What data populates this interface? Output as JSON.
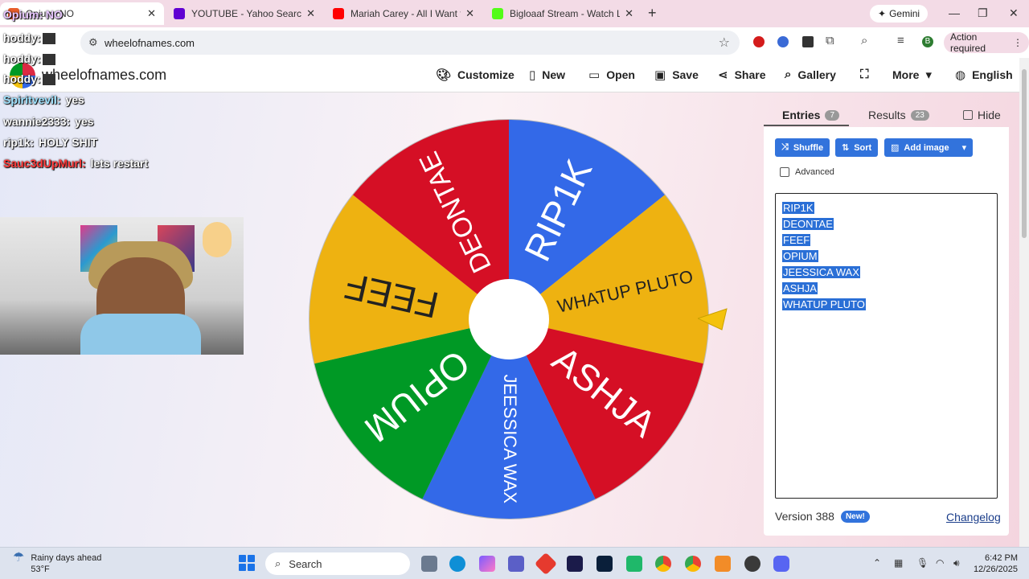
{
  "browser": {
    "tabs": [
      {
        "title": "Opium: NO",
        "favicon_color": "#e85d2a",
        "active": true
      },
      {
        "title": "YOUTUBE - Yahoo Search Resul",
        "favicon_color": "#6001d2"
      },
      {
        "title": "Mariah Carey - All I Want for Ch",
        "favicon_color": "#ff0000"
      },
      {
        "title": "Bigloaaf Stream - Watch Live o",
        "favicon_color": "#53fc18"
      }
    ],
    "new_tab_label": "+",
    "gemini_label": "Gemini",
    "url": "wheelofnames.com",
    "action_required_label": "Action required",
    "profile_initial": "B"
  },
  "site": {
    "name": "wheelofnames.com",
    "menu": [
      {
        "label": "Customize",
        "icon": "palette-icon"
      },
      {
        "label": "New",
        "icon": "file-icon"
      },
      {
        "label": "Open",
        "icon": "folder-icon"
      },
      {
        "label": "Save",
        "icon": "save-icon"
      },
      {
        "label": "Share",
        "icon": "share-icon"
      },
      {
        "label": "Gallery",
        "icon": "search-icon"
      },
      {
        "label": "More",
        "icon": "chevron-down-icon"
      },
      {
        "label": "English",
        "icon": "globe-icon"
      }
    ]
  },
  "chat": [
    {
      "user": "hoddy:",
      "message": ""
    },
    {
      "user": "hoddy:",
      "message": ""
    },
    {
      "user": "hoddy:",
      "message": ""
    },
    {
      "user": "Spiritvevil:",
      "message": "yes"
    },
    {
      "user": "wannie2333:",
      "message": "yes"
    },
    {
      "user": "rip1k:",
      "message": "HOLY SHIT"
    },
    {
      "user": "Sauc3dUpMurl:",
      "message": "lets restart"
    }
  ],
  "wheel": {
    "entries": [
      "RIP1K",
      "WHATUP PLUTO",
      "ASHJA",
      "JEESSICA WAX",
      "OPIUM",
      "FEEF",
      "DEONTAE"
    ],
    "colors": [
      "#3369e8",
      "#eeb211",
      "#d50f25",
      "#3369e8",
      "#009925",
      "#eeb211",
      "#d50f25"
    ]
  },
  "panel": {
    "tabs": {
      "entries_label": "Entries",
      "entries_count": "7",
      "results_label": "Results",
      "results_count": "23",
      "hide_label": "Hide"
    },
    "buttons": {
      "shuffle": "Shuffle",
      "sort": "Sort",
      "add_image": "Add image"
    },
    "advanced_label": "Advanced",
    "entries": [
      "RIP1K",
      "DEONTAE",
      "FEEF",
      "OPIUM",
      "JEESSICA WAX",
      "ASHJA",
      "WHATUP PLUTO"
    ],
    "version_label": "Version 388",
    "new_badge": "New!",
    "changelog_label": "Changelog"
  },
  "taskbar": {
    "weather_title": "Rainy days ahead",
    "weather_temp": "53°F",
    "search_label": "Search",
    "time": "6:42 PM",
    "date": "12/26/2025"
  }
}
